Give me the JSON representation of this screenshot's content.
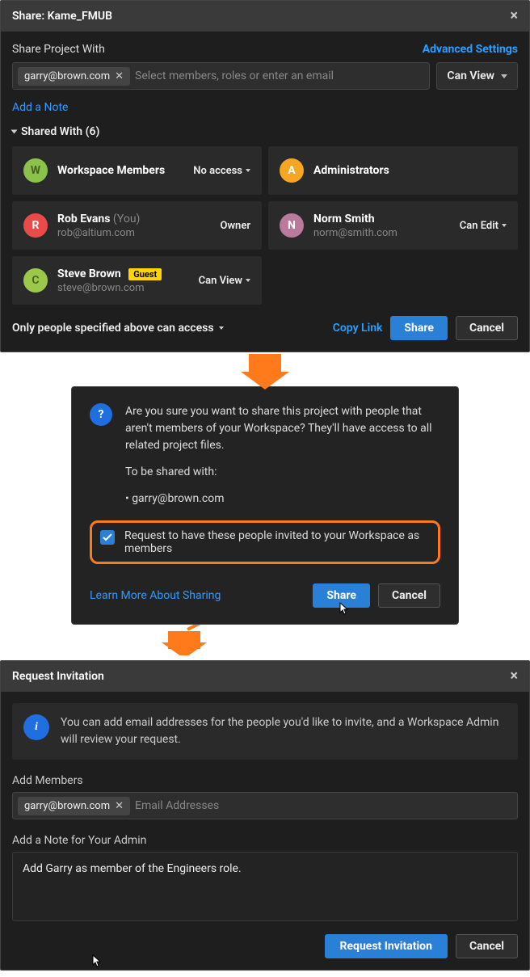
{
  "share_dialog": {
    "title": "Share: Kame_FMUB",
    "share_with_label": "Share Project With",
    "advanced_settings": "Advanced Settings",
    "token_email": "garry@brown.com",
    "input_placeholder": "Select members, roles or enter an email",
    "permission_select": "Can View",
    "add_note_link": "Add a Note",
    "shared_with_header": "Shared With (6)",
    "footer_access_label": "Only people specified above can access",
    "copy_link": "Copy Link",
    "share_btn": "Share",
    "cancel_btn": "Cancel"
  },
  "cards": [
    {
      "letter": "W",
      "color": "#8bc34a",
      "textClass": "",
      "name": "Workspace Members",
      "sub": "",
      "role": "No access",
      "caret": true
    },
    {
      "letter": "A",
      "color": "#f5a623",
      "textClass": "txt-white",
      "name": "Administrators",
      "sub": "",
      "role": "",
      "caret": false
    },
    {
      "letter": "R",
      "color": "#e94b4b",
      "textClass": "txt-white",
      "name": "Rob Evans",
      "you": "(You)",
      "sub": "rob@altium.com",
      "role": "Owner",
      "caret": false
    },
    {
      "letter": "N",
      "color": "#b97a9b",
      "textClass": "txt-white",
      "name": "Norm Smith",
      "sub": "norm@smith.com",
      "role": "Can Edit",
      "caret": true
    },
    {
      "letter": "C",
      "color": "#9cc84a",
      "textClass": "",
      "name": "Steve Brown",
      "guest": "Guest",
      "sub": "steve@brown.com",
      "role": "Can View",
      "caret": true
    }
  ],
  "confirm": {
    "text1": "Are you sure you want to share this project with people that aren't members of your Workspace? They'll have access to all related project files.",
    "to_be_shared": "To be shared with:",
    "bullet": "• garry@brown.com",
    "checkbox_label": "Request to have these people invited to your Workspace as members",
    "learn_more": "Learn More About Sharing",
    "share_btn": "Share",
    "cancel_btn": "Cancel"
  },
  "request": {
    "title": "Request Invitation",
    "info": "You can add email addresses for the people you'd like to invite, and a Workspace Admin will review your request.",
    "add_members_label": "Add Members",
    "token_email": "garry@brown.com",
    "placeholder": "Email Addresses",
    "note_label": "Add a Note for Your Admin",
    "note_value": "Add Garry as member of the Engineers role.",
    "request_btn": "Request Invitation",
    "cancel_btn": "Cancel"
  }
}
